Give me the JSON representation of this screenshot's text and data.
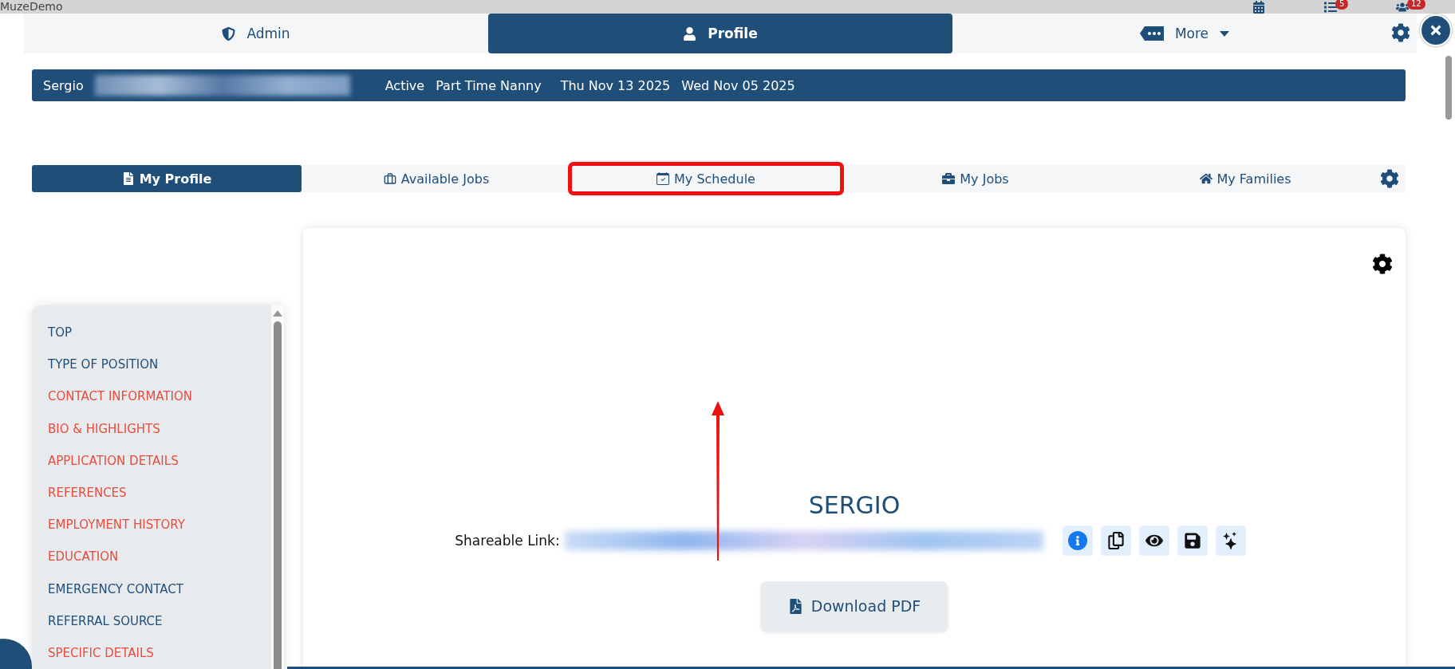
{
  "browser_strip": {
    "broken_image_alt": "MuzeDemo",
    "badges": [
      {
        "kind": "list",
        "count": "5"
      },
      {
        "kind": "people",
        "count": "12"
      }
    ]
  },
  "nav": [
    {
      "label": "Admin",
      "selected": false
    },
    {
      "label": "Profile",
      "selected": true
    },
    {
      "label": "More",
      "selected": false
    }
  ],
  "info_bar": {
    "first_name": "Sergio",
    "status": "Active",
    "position": "Part Time Nanny",
    "date_1": "Thu Nov 13 2025",
    "date_2": "Wed Nov 05 2025"
  },
  "tabs": [
    {
      "label": "My Profile",
      "selected": true,
      "highlighted": false
    },
    {
      "label": "Available Jobs",
      "selected": false,
      "highlighted": false
    },
    {
      "label": "My Schedule",
      "selected": false,
      "highlighted": true
    },
    {
      "label": "My Jobs",
      "selected": false,
      "highlighted": false
    },
    {
      "label": "My Families",
      "selected": false,
      "highlighted": false
    }
  ],
  "sidebar": {
    "items": [
      {
        "label": "TOP",
        "incomplete": false
      },
      {
        "label": "TYPE OF POSITION",
        "incomplete": false
      },
      {
        "label": "CONTACT INFORMATION",
        "incomplete": true
      },
      {
        "label": "BIO & HIGHLIGHTS",
        "incomplete": true
      },
      {
        "label": "APPLICATION DETAILS",
        "incomplete": true
      },
      {
        "label": "REFERENCES",
        "incomplete": true
      },
      {
        "label": "EMPLOYMENT HISTORY",
        "incomplete": true
      },
      {
        "label": "EDUCATION",
        "incomplete": true
      },
      {
        "label": "EMERGENCY CONTACT",
        "incomplete": false
      },
      {
        "label": "REFERRAL SOURCE",
        "incomplete": false
      },
      {
        "label": "SPECIFIC DETAILS",
        "incomplete": true
      }
    ]
  },
  "profile": {
    "name": "SERGIO",
    "share_label": "Shareable Link:",
    "link_actions": [
      {
        "kind": "info"
      },
      {
        "kind": "copy"
      },
      {
        "kind": "view"
      },
      {
        "kind": "save"
      },
      {
        "kind": "sparkle"
      }
    ],
    "download_button": "Download PDF"
  }
}
